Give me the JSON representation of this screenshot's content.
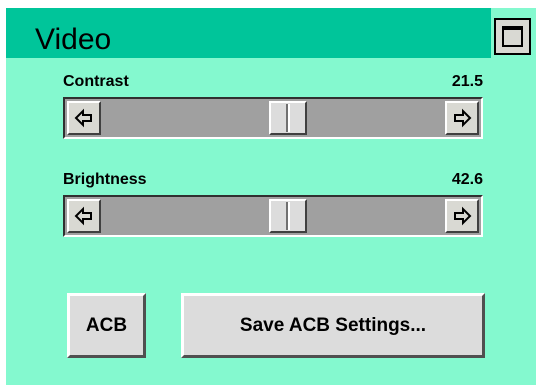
{
  "window": {
    "title": "Video",
    "maximize_icon": "maximize-icon"
  },
  "sliders": [
    {
      "label": "Contrast",
      "value": "21.5",
      "level_fraction": 0.55
    },
    {
      "label": "Brightness",
      "value": "42.6",
      "level_fraction": 0.55
    }
  ],
  "buttons": {
    "acb": "ACB",
    "save_acb": "Save ACB Settings..."
  },
  "colors": {
    "panel_bg": "#84f9cf",
    "titlebar_bg": "#00c59a"
  }
}
